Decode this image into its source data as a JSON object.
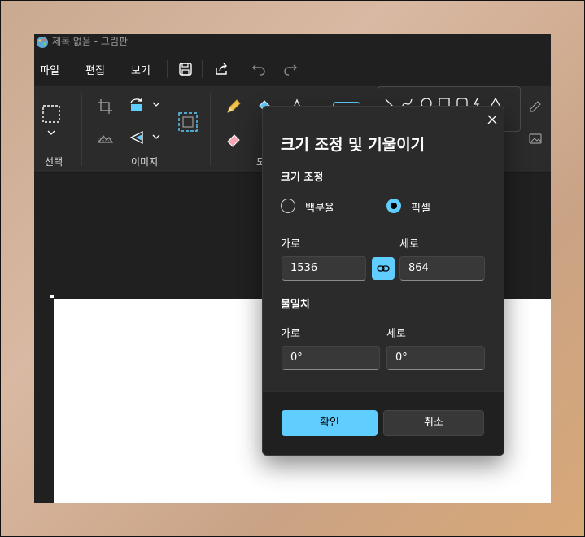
{
  "window": {
    "title": "제목 없음 - 그림판"
  },
  "menu": {
    "file": "파일",
    "edit": "편집",
    "view": "보기"
  },
  "ribbon": {
    "selection_label": "선택",
    "image_label": "이미지",
    "tools_label_partial": "도"
  },
  "dialog": {
    "title": "크기 조정 및 기울이기",
    "resize_section": "크기 조정",
    "radio_percent": "백분율",
    "radio_pixel": "픽셀",
    "selected_unit": "픽셀",
    "resize_width_label": "가로",
    "resize_height_label": "세로",
    "resize_width_value": "1536",
    "resize_height_value": "864",
    "skew_section": "불일치",
    "skew_horizontal_label": "가로",
    "skew_vertical_label": "세로",
    "skew_horizontal_value": "0°",
    "skew_vertical_value": "0°",
    "ok_label": "확인",
    "cancel_label": "취소"
  },
  "colors": {
    "accent": "#60cdff",
    "window_bg": "#202020",
    "ribbon_bg": "#2b2b2b",
    "dialog_bg": "#2b2b2b"
  },
  "icons": [
    "app-icon",
    "save-icon",
    "share-icon",
    "undo-icon",
    "redo-icon",
    "select-icon",
    "chevron-down-icon",
    "crop-icon",
    "rotate-icon",
    "remove-background-icon",
    "flip-icon",
    "resize-icon",
    "pencil-icon",
    "fill-icon",
    "text-icon",
    "eraser-icon",
    "shapes-icon",
    "close-icon",
    "link-icon"
  ]
}
